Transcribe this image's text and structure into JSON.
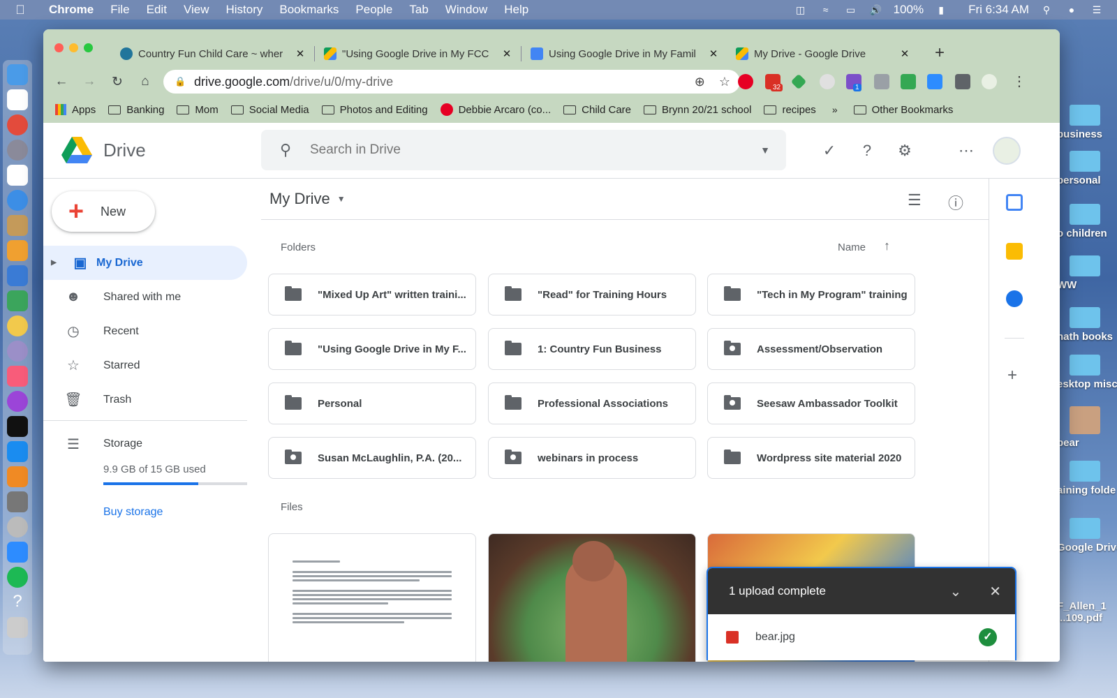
{
  "menubar": {
    "app": "Chrome",
    "items": [
      "File",
      "Edit",
      "View",
      "History",
      "Bookmarks",
      "People",
      "Tab",
      "Window",
      "Help"
    ],
    "battery": "100%",
    "clock": "Fri 6:34 AM"
  },
  "tabs": [
    {
      "title": "Country Fun Child Care ~ wher",
      "active": false
    },
    {
      "title": "\"Using Google Drive in My FCC",
      "active": false
    },
    {
      "title": "Using Google Drive in My Famil",
      "active": false
    },
    {
      "title": "My Drive - Google Drive",
      "active": true
    }
  ],
  "address": {
    "host": "drive.google.com",
    "path": "/drive/u/0/my-drive"
  },
  "extensions": {
    "gmail_badge": "32",
    "r_badge": "1"
  },
  "bookmarks": {
    "items": [
      "Apps",
      "Banking",
      "Mom",
      "Social Media",
      "Photos and Editing",
      "Debbie Arcaro (co...",
      "Child Care",
      "Brynn 20/21 school",
      "recipes"
    ],
    "overflow": "»",
    "other": "Other Bookmarks"
  },
  "drive": {
    "brand": "Drive",
    "search_placeholder": "Search in Drive",
    "new_label": "New",
    "nav": [
      {
        "label": "My Drive",
        "icon": "my-drive-icon",
        "active": true
      },
      {
        "label": "Shared with me",
        "icon": "people-icon",
        "active": false
      },
      {
        "label": "Recent",
        "icon": "clock-icon",
        "active": false
      },
      {
        "label": "Starred",
        "icon": "star-icon",
        "active": false
      },
      {
        "label": "Trash",
        "icon": "trash-icon",
        "active": false
      }
    ],
    "storage": {
      "label": "Storage",
      "used_text": "9.9 GB of 15 GB used",
      "used_fraction": 0.66,
      "buy": "Buy storage"
    },
    "title": "My Drive",
    "folders_label": "Folders",
    "sort_label": "Name",
    "files_label": "Files",
    "folders": [
      {
        "name": "\"Mixed Up Art\" written traini...",
        "shared": false
      },
      {
        "name": "\"Read\" for Training Hours",
        "shared": false
      },
      {
        "name": "\"Tech in My Program\" training",
        "shared": false
      },
      {
        "name": "\"Using Google Drive in My F...",
        "shared": false
      },
      {
        "name": "1: Country Fun Business",
        "shared": false
      },
      {
        "name": "Assessment/Observation",
        "shared": true
      },
      {
        "name": "Personal",
        "shared": false
      },
      {
        "name": "Professional Associations",
        "shared": false
      },
      {
        "name": "Seesaw Ambassador Toolkit",
        "shared": true
      },
      {
        "name": "Susan McLaughlin, P.A. (20...",
        "shared": true
      },
      {
        "name": "webinars in process",
        "shared": true
      },
      {
        "name": "Wordpress site material 2020",
        "shared": false
      }
    ],
    "upload": {
      "title": "1 upload complete",
      "file": "bear.jpg"
    }
  },
  "desktop": [
    "business",
    "personal",
    "o children",
    "WW",
    "nath books",
    "esktop misc",
    "bear",
    "aining folde",
    "Google Drive",
    "F_Allen_1",
    "...109.pdf"
  ],
  "colors": {
    "accent": "#1a73e8",
    "active_bg": "#e8f0fe",
    "chrome_frame": "#c6d8c1"
  }
}
